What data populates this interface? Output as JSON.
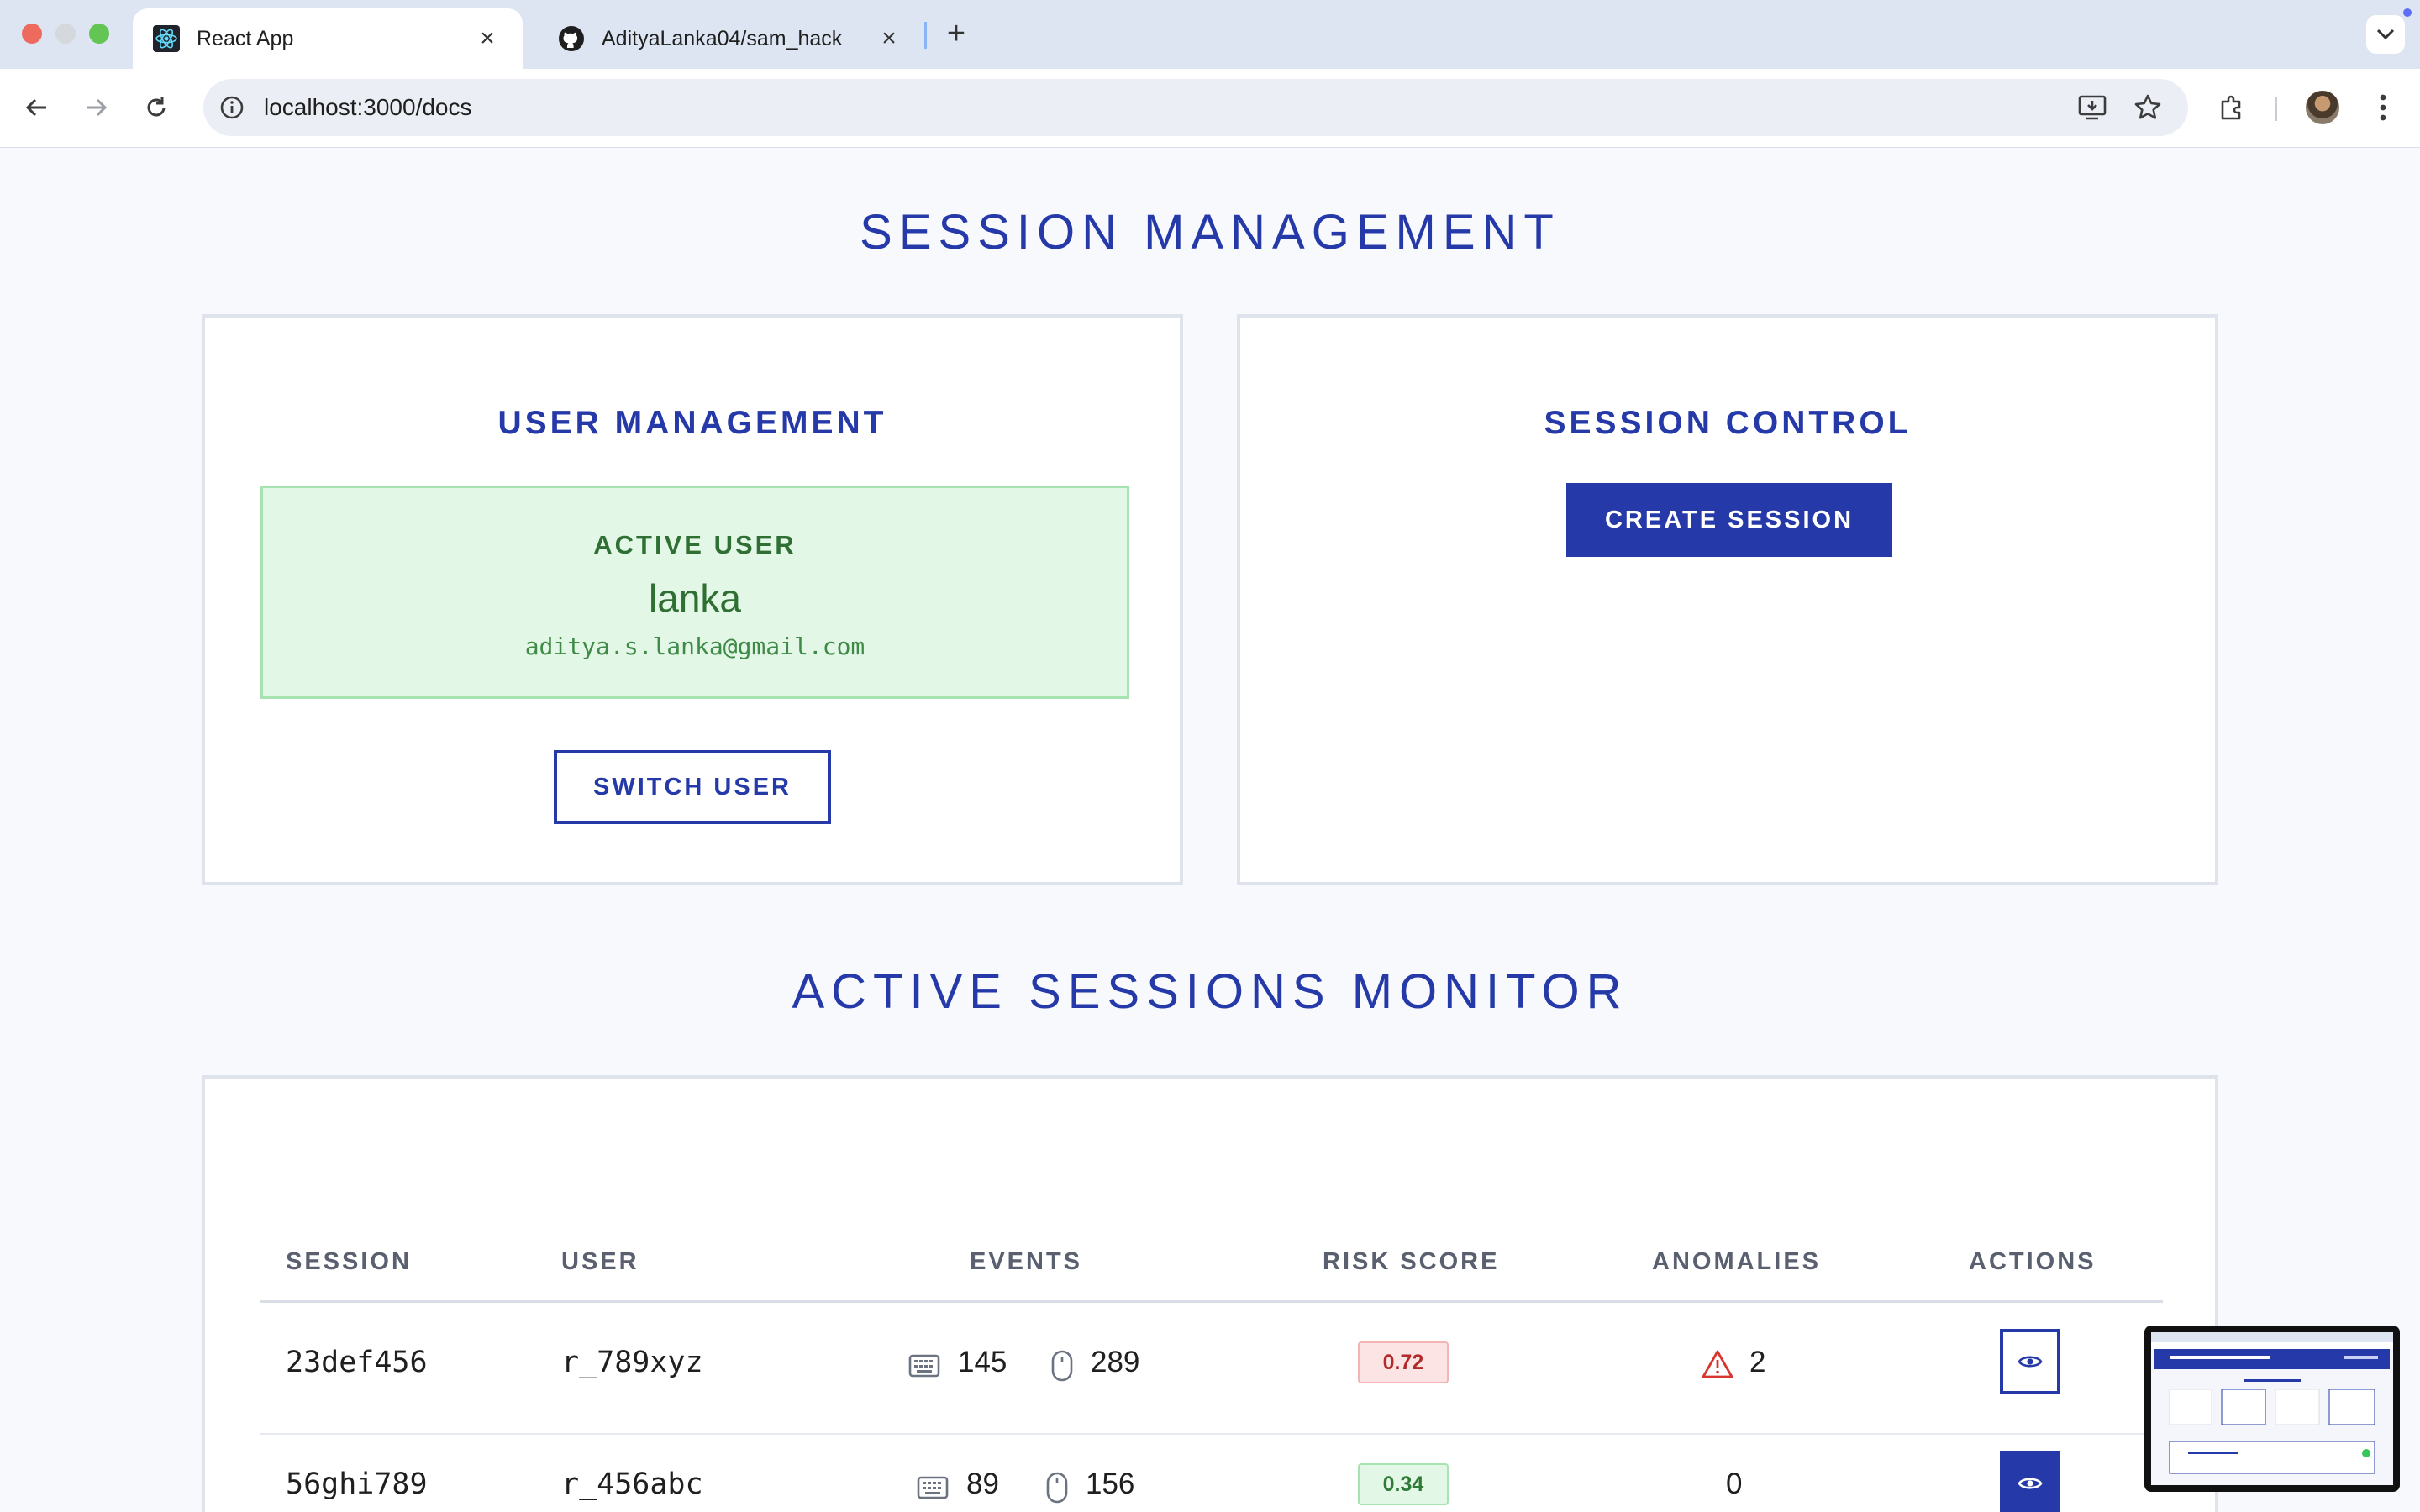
{
  "browser": {
    "tabs": [
      {
        "title": "React App",
        "icon": "react-icon",
        "active": true
      },
      {
        "title": "AdityaLanka04/sam_hack",
        "icon": "github-icon",
        "active": false
      }
    ],
    "url": "localhost:3000/docs"
  },
  "page": {
    "session_management_title": "SESSION MANAGEMENT",
    "user_management": {
      "title": "USER MANAGEMENT",
      "active_user_label": "ACTIVE USER",
      "user_name": "lanka",
      "user_email": "aditya.s.lanka@gmail.com",
      "switch_user_label": "SWITCH USER"
    },
    "session_control": {
      "title": "SESSION CONTROL",
      "create_session_label": "CREATE SESSION"
    },
    "monitor_title": "ACTIVE SESSIONS MONITOR",
    "table": {
      "headers": [
        "SESSION",
        "USER",
        "EVENTS",
        "RISK SCORE",
        "ANOMALIES",
        "ACTIONS"
      ],
      "rows": [
        {
          "session": "23def456",
          "user": "r_789xyz",
          "keyboard_events": "145",
          "mouse_events": "289",
          "risk_score": "0.72",
          "risk_level": "high",
          "anomalies": "2",
          "has_warning": true
        },
        {
          "session": "56ghi789",
          "user": "r_456abc",
          "keyboard_events": "89",
          "mouse_events": "156",
          "risk_score": "0.34",
          "risk_level": "low",
          "anomalies": "0",
          "has_warning": false
        }
      ]
    }
  },
  "colors": {
    "accent": "#2539a8",
    "success_bg": "#e3f7e6",
    "danger": "#b32a2a"
  }
}
